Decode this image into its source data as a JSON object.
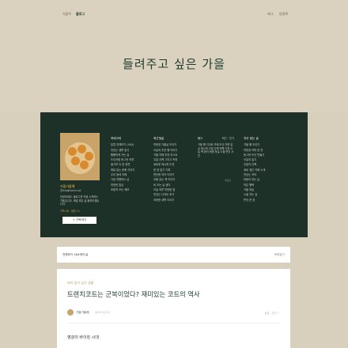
{
  "header": {
    "blog_name": "가을주",
    "blog_name_selected": "블로그",
    "link_1": "태그",
    "link_2": "방명록",
    "title": "들려주고 싶은 가을"
  },
  "profile": {
    "name": "가을가을해",
    "id": "@bloghood.cat",
    "desc": "안녕하세요. 블로그를 처음 시작하는 가을입니다. 매일 좋은 글 올려보겠습니다.",
    "meta": "구독 46 · 방문 11",
    "subscribe": "+ 구독하기"
  },
  "categories": {
    "heading": "카테고리",
    "items": [
      "분류 전체보기 (184)",
      "맛있는 생활 일기",
      "빵빵하게 가는 길",
      "도넛처럼 동그란 하루",
      "밀가루 속 한 장면",
      "매일 읽는 문화 이야기",
      "우리 동네 카페",
      "가끔 여행하는 날",
      "따뜻한 일상",
      "조용히 쓰는 메모"
    ]
  },
  "recent_posts": {
    "heading": "최근댓글",
    "items": [
      "따뜻한 가을날 이야기",
      "오늘의 추천 빵 이야기",
      "가을 카페 추천 리스트",
      "주말 산책 그리고 커피",
      "새로운 레시피 도전",
      "한 장 일기 기록",
      "편안한 저녁 이야기",
      "요즘 읽는 책 이야기",
      "비 오는 날 생각",
      "오늘 하루 따뜻한 말",
      "맛있는 디저트 후기",
      "조용한 새벽 이야기"
    ]
  },
  "tags": {
    "heading": "태그",
    "more_link": "최근 · 인기",
    "text": "가을 빵 디저트 카페 도넛 커피 일상 레시피 주말 산책 여행 기록 오늘 책 음악 바람 하늘 노을 편지 사진",
    "more": "더보기"
  },
  "recent_comments": {
    "heading": "자주 찾는 글",
    "items": [
      "가을 빵 이야기",
      "따뜻한 커피 한 잔",
      "동그란 도넛 만들기",
      "오늘의 일기",
      "주말의 산책",
      "새로 생긴 카페 소개",
      "맛있는 저녁",
      "바람이 부는 날",
      "작은 행복",
      "가을 하늘",
      "노을 지는 길",
      "편지 한 장"
    ]
  },
  "summary": {
    "left": "전체보기 184개의 글",
    "right": "목록열기"
  },
  "article": {
    "category": "여러 읽기 싶은 생활",
    "title": "트렌치코트는 군복이었다? 재미있는 코트의 역사",
    "author": "가을가을해",
    "date": "2023.10.13",
    "stats": "공유 · 신고 ···",
    "subheading": "영광의 바이킹 시대"
  },
  "colors": {
    "header_bg": "#dad1bf",
    "panel_bg": "#1e3128",
    "accent": "#f3c34a",
    "title": "#1f3a2f"
  }
}
